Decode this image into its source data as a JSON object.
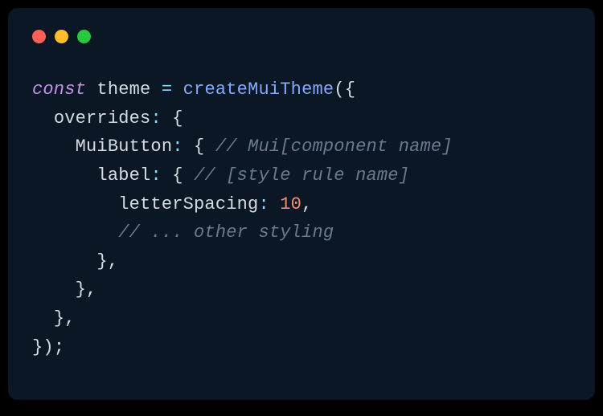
{
  "tokens": {
    "const": "const",
    "theme": "theme",
    "eq": "=",
    "createMuiTheme": "createMuiTheme",
    "lparen": "(",
    "rparen": ")",
    "lbrace": "{",
    "rbrace": "}",
    "colon": ":",
    "comma": ",",
    "semi": ";",
    "overrides": "overrides",
    "MuiButton": "MuiButton",
    "label": "label",
    "letterSpacing": "letterSpacing",
    "ten": "10",
    "comment_component": "// Mui[component name]",
    "comment_rule": "// [style rule name]",
    "comment_other": "// ... other styling"
  },
  "colors": {
    "bg": "#0b1724",
    "keyword": "#c792ea",
    "func": "#82aaff",
    "operator": "#89ddff",
    "number": "#f78c6c",
    "comment": "#697a8e",
    "text": "#cbd5e1"
  }
}
